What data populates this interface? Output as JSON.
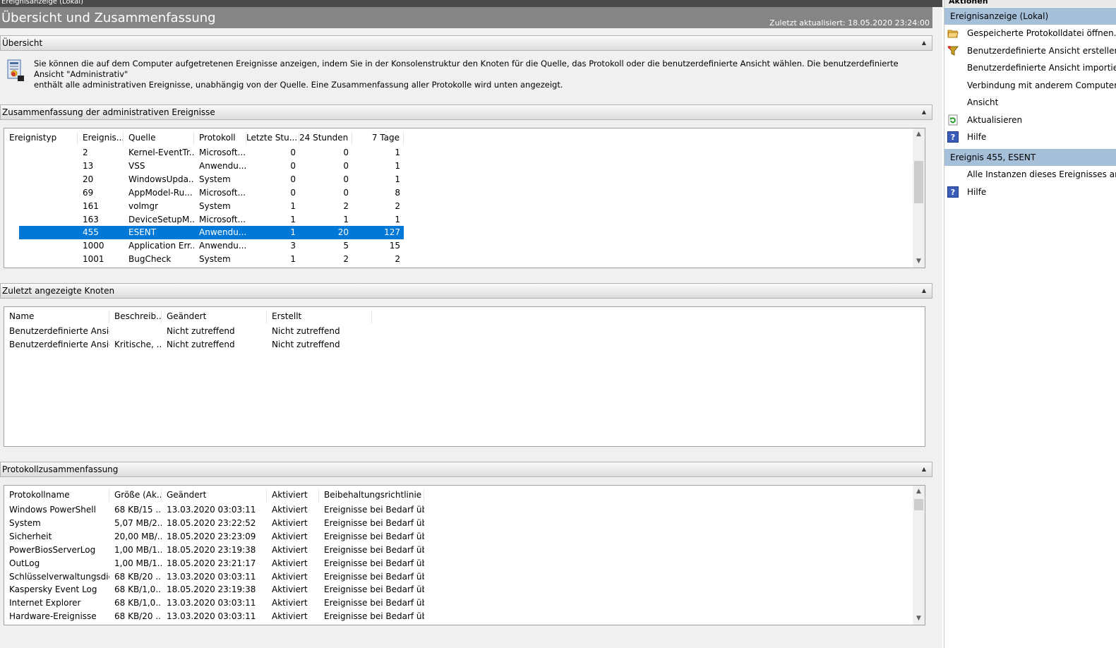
{
  "window": {
    "top_title": "Ereignisanzeige (Lokal)"
  },
  "header": {
    "title": "Übersicht und Zusammenfassung",
    "updated": "Zuletzt aktualisiert: 18.05.2020 23:24:00"
  },
  "overview": {
    "title": "Übersicht",
    "text_line1": "Sie können die auf dem Computer aufgetretenen Ereignisse anzeigen, indem Sie in der Konsolenstruktur den Knoten für die Quelle, das Protokoll oder die benutzerdefinierte Ansicht wählen. Die benutzerdefinierte Ansicht \"Administrativ\"",
    "text_line2": "enthält alle administrativen Ereignisse, unabhängig von der Quelle. Eine Zusammenfassung aller Protokolle wird unten angezeigt."
  },
  "admin_summary": {
    "title": "Zusammenfassung der administrativen Ereignisse",
    "columns": [
      "Ereignistyp",
      "Ereignis...",
      "Quelle",
      "Protokoll",
      "Letzte Stu...",
      "24 Stunden",
      "7 Tage"
    ],
    "rows": [
      [
        "",
        "2",
        "Kernel-EventTr...",
        "Microsoft...",
        "0",
        "0",
        "1"
      ],
      [
        "",
        "13",
        "VSS",
        "Anwendu...",
        "0",
        "0",
        "1"
      ],
      [
        "",
        "20",
        "WindowsUpda...",
        "System",
        "0",
        "0",
        "1"
      ],
      [
        "",
        "69",
        "AppModel-Ru...",
        "Microsoft...",
        "0",
        "0",
        "8"
      ],
      [
        "",
        "161",
        "volmgr",
        "System",
        "1",
        "2",
        "2"
      ],
      [
        "",
        "163",
        "DeviceSetupM...",
        "Microsoft...",
        "1",
        "1",
        "1"
      ],
      [
        "",
        "455",
        "ESENT",
        "Anwendu...",
        "1",
        "20",
        "127"
      ],
      [
        "",
        "1000",
        "Application Err...",
        "Anwendu...",
        "3",
        "5",
        "15"
      ],
      [
        "",
        "1001",
        "BugCheck",
        "System",
        "1",
        "2",
        "2"
      ]
    ],
    "selected_row": 6
  },
  "recent_nodes": {
    "title": "Zuletzt angezeigte Knoten",
    "columns": [
      "Name",
      "Beschreib...",
      "Geändert",
      "Erstellt"
    ],
    "rows": [
      [
        "Benutzerdefinierte Ansic...",
        "",
        "Nicht zutreffend",
        "Nicht zutreffend"
      ],
      [
        "Benutzerdefinierte Ansic...",
        "Kritische, ...",
        "Nicht zutreffend",
        "Nicht zutreffend"
      ]
    ]
  },
  "log_summary": {
    "title": "Protokollzusammenfassung",
    "columns": [
      "Protokollname",
      "Größe (Ak...",
      "Geändert",
      "Aktiviert",
      "Beibehaltungsrichtlinie"
    ],
    "rows": [
      [
        "Windows PowerShell",
        "68 KB/15 ...",
        "13.03.2020 03:03:11",
        "Aktiviert",
        "Ereignisse bei Bedarf üb..."
      ],
      [
        "System",
        "5,07 MB/2...",
        "18.05.2020 23:22:52",
        "Aktiviert",
        "Ereignisse bei Bedarf üb..."
      ],
      [
        "Sicherheit",
        "20,00 MB/...",
        "18.05.2020 23:23:09",
        "Aktiviert",
        "Ereignisse bei Bedarf üb..."
      ],
      [
        "PowerBiosServerLog",
        "1,00 MB/1...",
        "18.05.2020 23:19:38",
        "Aktiviert",
        "Ereignisse bei Bedarf üb..."
      ],
      [
        "OutLog",
        "1,00 MB/1...",
        "18.05.2020 23:21:17",
        "Aktiviert",
        "Ereignisse bei Bedarf üb..."
      ],
      [
        "Schlüsselverwaltungsdie...",
        "68 KB/20 ...",
        "13.03.2020 03:03:11",
        "Aktiviert",
        "Ereignisse bei Bedarf üb..."
      ],
      [
        "Kaspersky Event Log",
        "68 KB/1,0...",
        "18.05.2020 23:19:38",
        "Aktiviert",
        "Ereignisse bei Bedarf üb..."
      ],
      [
        "Internet Explorer",
        "68 KB/1,0...",
        "13.03.2020 03:03:11",
        "Aktiviert",
        "Ereignisse bei Bedarf üb..."
      ],
      [
        "Hardware-Ereignisse",
        "68 KB/20 ...",
        "13.03.2020 03:03:11",
        "Aktiviert",
        "Ereignisse bei Bedarf üb..."
      ]
    ]
  },
  "actions": {
    "title": "Aktionen",
    "group1": {
      "title": "Ereignisanzeige (Lokal)",
      "items": [
        {
          "label": "Gespeicherte Protokolldatei öffnen...",
          "icon": "folder-open-icon"
        },
        {
          "label": "Benutzerdefinierte Ansicht erstellen...",
          "icon": "filter-icon"
        },
        {
          "label": "Benutzerdefinierte Ansicht importieren...",
          "icon": ""
        },
        {
          "label": "Verbindung mit anderem Computer herstellen...",
          "icon": ""
        },
        {
          "label": "Ansicht",
          "icon": ""
        },
        {
          "label": "Aktualisieren",
          "icon": "refresh-icon"
        },
        {
          "label": "Hilfe",
          "icon": "help-icon"
        }
      ]
    },
    "group2": {
      "title": "Ereignis 455, ESENT",
      "items": [
        {
          "label": "Alle Instanzen dieses Ereignisses anzeigen",
          "icon": ""
        },
        {
          "label": "Hilfe",
          "icon": "help-icon"
        }
      ]
    }
  },
  "colors": {
    "selection": "#0078d7",
    "title_bar": "#858585",
    "action_header": "#a7c0d9"
  }
}
